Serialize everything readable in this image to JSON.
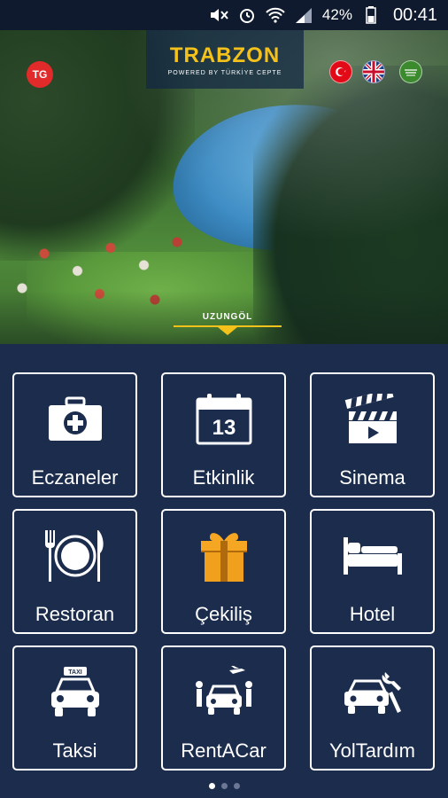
{
  "status_bar": {
    "battery_percent": "42%",
    "time": "00:41",
    "icons": [
      "mute-icon",
      "alarm-icon",
      "wifi-icon",
      "signal-icon",
      "battery-icon"
    ]
  },
  "hero": {
    "brand_logo": "TG",
    "title": "TRABZON",
    "subtitle": "POWERED BY TÜRKİYE CEPTE",
    "location": "UZUNGÖL",
    "languages": [
      "tr-flag",
      "en-flag",
      "ar-flag"
    ]
  },
  "grid": {
    "items": [
      {
        "label": "Eczaneler",
        "icon": "first-aid-kit-icon"
      },
      {
        "label": "Etkinlik",
        "icon": "calendar-icon",
        "day": "13"
      },
      {
        "label": "Sinema",
        "icon": "clapperboard-icon"
      },
      {
        "label": "Restoran",
        "icon": "plate-cutlery-icon"
      },
      {
        "label": "Çekiliş",
        "icon": "gift-icon"
      },
      {
        "label": "Hotel",
        "icon": "bed-icon"
      },
      {
        "label": "Taksi",
        "icon": "taxi-icon"
      },
      {
        "label": "RentACar",
        "icon": "rent-a-car-icon"
      },
      {
        "label": "YolTardım",
        "icon": "roadside-assistance-icon"
      }
    ]
  },
  "pager": {
    "total": 3,
    "active_index": 0
  },
  "colors": {
    "background": "#1b2c4c",
    "accent": "#f5c21b",
    "tile_border": "#ffffff"
  }
}
